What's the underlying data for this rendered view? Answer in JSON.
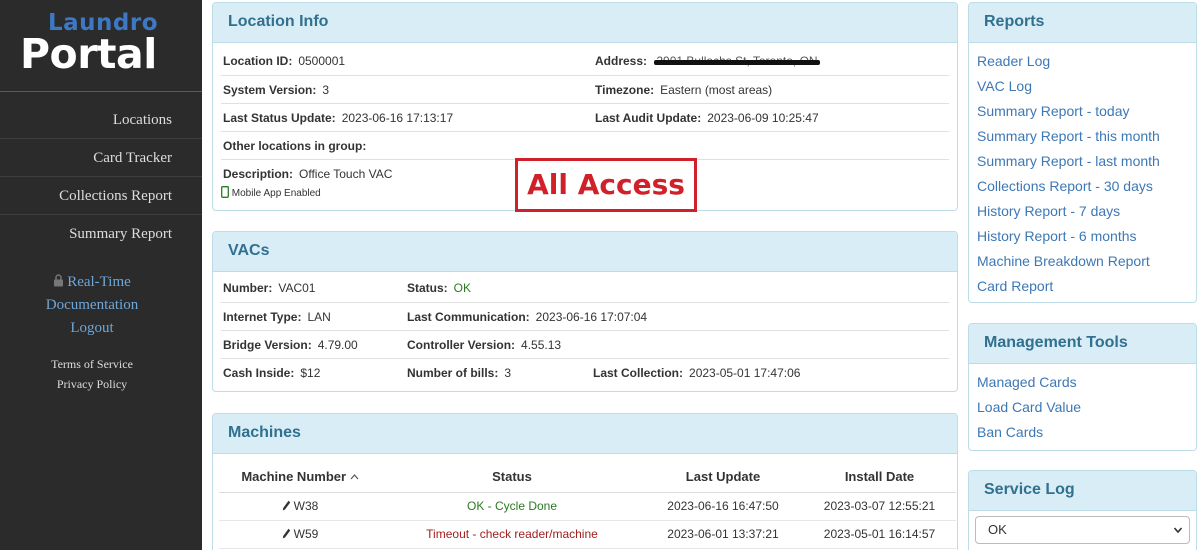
{
  "logo": {
    "line1": "Laundro",
    "line2": "Portal"
  },
  "sidebar": {
    "nav": [
      "Locations",
      "Card Tracker",
      "Collections Report",
      "Summary Report"
    ],
    "links": {
      "realtime": "Real-Time",
      "documentation": "Documentation",
      "logout": "Logout"
    },
    "terms": "Terms of Service",
    "privacy": "Privacy Policy"
  },
  "location_info": {
    "title": "Location Info",
    "location_id_label": "Location ID:",
    "location_id": "0500001",
    "address_label": "Address:",
    "address": "2901 Bullochs St, Toronto, ON",
    "system_version_label": "System Version:",
    "system_version": "3",
    "timezone_label": "Timezone:",
    "timezone": "Eastern (most areas)",
    "last_status_label": "Last Status Update:",
    "last_status": "2023-06-16 17:13:17",
    "last_audit_label": "Last Audit Update:",
    "last_audit": "2023-06-09 10:25:47",
    "other_locations_label": "Other locations in group:",
    "description_label": "Description:",
    "description": "Office Touch VAC",
    "mobile_app": "Mobile App Enabled"
  },
  "watermark": "All Access",
  "vacs": {
    "title": "VACs",
    "number_label": "Number:",
    "number": "VAC01",
    "status_label": "Status:",
    "status": "OK",
    "internet_type_label": "Internet Type:",
    "internet_type": "LAN",
    "last_comm_label": "Last Communication:",
    "last_comm": "2023-06-16 17:07:04",
    "bridge_version_label": "Bridge Version:",
    "bridge_version": "4.79.00",
    "controller_version_label": "Controller Version:",
    "controller_version": "4.55.13",
    "cash_inside_label": "Cash Inside:",
    "cash_inside": "$12",
    "num_bills_label": "Number of bills:",
    "num_bills": "3",
    "last_collection_label": "Last Collection:",
    "last_collection": "2023-05-01 17:47:06"
  },
  "machines": {
    "title": "Machines",
    "columns": [
      "Machine Number",
      "Status",
      "Last Update",
      "Install Date"
    ],
    "rows": [
      {
        "number": "W38",
        "status": "OK - Cycle Done",
        "status_color": "#2b7a22",
        "last_update": "2023-06-16 16:47:50",
        "install_date": "2023-03-07 12:55:21"
      },
      {
        "number": "W59",
        "status": "Timeout - check reader/machine",
        "status_color": "#a31e1e",
        "last_update": "2023-06-01 13:37:21",
        "install_date": "2023-05-01 16:14:57"
      }
    ]
  },
  "reports": {
    "title": "Reports",
    "items": [
      "Reader Log",
      "VAC Log",
      "Summary Report - today",
      "Summary Report - this month",
      "Summary Report - last month",
      "Collections Report - 30 days",
      "History Report - 7 days",
      "History Report - 6 months",
      "Machine Breakdown Report",
      "Card Report"
    ]
  },
  "management": {
    "title": "Management Tools",
    "items": [
      "Managed Cards",
      "Load Card Value",
      "Ban Cards"
    ]
  },
  "service_log": {
    "title": "Service Log",
    "selected": "OK"
  }
}
